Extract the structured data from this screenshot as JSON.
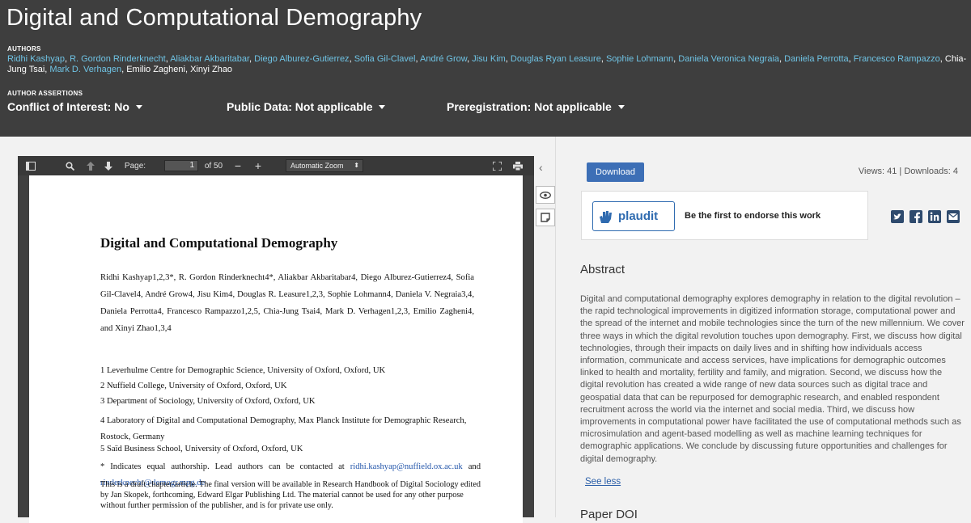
{
  "header": {
    "title": "Digital and Computational Demography",
    "authors_label": "AUTHORS",
    "authors": [
      {
        "name": "Ridhi Kashyap",
        "linked": true
      },
      {
        "name": "R. Gordon Rinderknecht",
        "linked": true
      },
      {
        "name": "Aliakbar Akbaritabar",
        "linked": true
      },
      {
        "name": "Diego Alburez-Gutierrez",
        "linked": true
      },
      {
        "name": "Sofia Gil-Clavel",
        "linked": true
      },
      {
        "name": "André Grow",
        "linked": true
      },
      {
        "name": "Jisu Kim",
        "linked": true
      },
      {
        "name": "Douglas Ryan Leasure",
        "linked": true
      },
      {
        "name": "Sophie Lohmann",
        "linked": true
      },
      {
        "name": "Daniela Veronica Negraia",
        "linked": true
      },
      {
        "name": "Daniela Perrotta",
        "linked": true
      },
      {
        "name": "Francesco Rampazzo",
        "linked": true
      },
      {
        "name": "Chia-Jung Tsai",
        "linked": false
      },
      {
        "name": "Mark D. Verhagen",
        "linked": true
      },
      {
        "name": "Emilio Zagheni",
        "linked": false
      },
      {
        "name": "Xinyi Zhao",
        "linked": false
      }
    ],
    "assertions_label": "AUTHOR ASSERTIONS",
    "conflict": "Conflict of Interest: No",
    "public_data": "Public Data: Not applicable",
    "prereg": "Preregistration: Not applicable"
  },
  "pdf": {
    "page_label": "Page:",
    "page_value": "1",
    "page_total": "of 50",
    "zoom": "Automatic Zoom",
    "doc_title": "Digital and Computational Demography",
    "doc_authors": "Ridhi Kashyap1,2,3*, R. Gordon Rinderknecht4*, Aliakbar Akbaritabar4, Diego Alburez-Gutierrez4, Sofia Gil-Clavel4, André Grow4, Jisu Kim4, Douglas R. Leasure1,2,3, Sophie Lohmann4, Daniela V. Negraia3,4, Daniela Perrotta4, Francesco Rampazzo1,2,5, Chia-Jung Tsai4, Mark D. Verhagen1,2,3, Emilio Zagheni4, and Xinyi Zhao1,3,4",
    "aff1": "1 Leverhulme Centre for Demographic Science, University of Oxford, Oxford, UK",
    "aff2": "2 Nuffield College, University of Oxford, Oxford, UK",
    "aff3": "3 Department of Sociology, University of Oxford, Oxford, UK",
    "aff4": "4 Laboratory of Digital and Computational Demography, Max Planck Institute for Demographic Research, Rostock, Germany",
    "aff5": "5 Saïd Business School, University of Oxford, Oxford, UK",
    "equal_note": "* Indicates equal authorship. Lead authors can be contacted at",
    "email1": "ridhi.kashyap@nuffield.ox.ac.uk",
    "and": "and",
    "email2": "rinderknecht@demogr.mpg.de",
    "draft": "This is a draft chapter/article. The final version will be available in Research Handbook of Digital Sociology edited by Jan Skopek, forthcoming, Edward Elgar Publishing Ltd. The material cannot be used for any other purpose without further permission of the publisher, and is for private use only."
  },
  "right": {
    "download": "Download",
    "stats": "Views: 41 | Downloads: 4",
    "plaudit": "plaudit",
    "endorse": "Be the first to endorse this work",
    "abstract_title": "Abstract",
    "abstract": "Digital and computational demography explores demography in relation to the digital revolution – the rapid technological improvements in digitized information storage, computational power and the spread of the internet and mobile technologies since the turn of the new millennium. We cover three ways in which the digital revolution touches upon demography. First, we discuss how digital technologies, through their impacts on daily lives and in shifting how individuals access information, communicate and access services, have implications for demographic outcomes linked to health and mortality, fertility and family, and migration. Second, we discuss how the digital revolution has created a wide range of new data sources such as digital trace and geospatial data that can be repurposed for demographic research, and enabled respondent recruitment across the world via the internet and social media. Third, we discuss how improvements in computational power have facilitated the use of computational methods such as microsimulation and agent-based modelling as well as machine learning techniques for demographic applications. We conclude by discussing future opportunities and challenges for digital demography.",
    "see_less": "See less",
    "paper_doi": "Paper DOI"
  },
  "icons": [
    "sidebar-toggle-icon",
    "search-icon",
    "previous-page-icon",
    "next-page-icon",
    "zoom-out-icon",
    "zoom-in-icon",
    "fullscreen-icon",
    "print-icon",
    "eye-icon",
    "note-icon",
    "twitter-icon",
    "facebook-icon",
    "linkedin-icon",
    "email-icon"
  ]
}
